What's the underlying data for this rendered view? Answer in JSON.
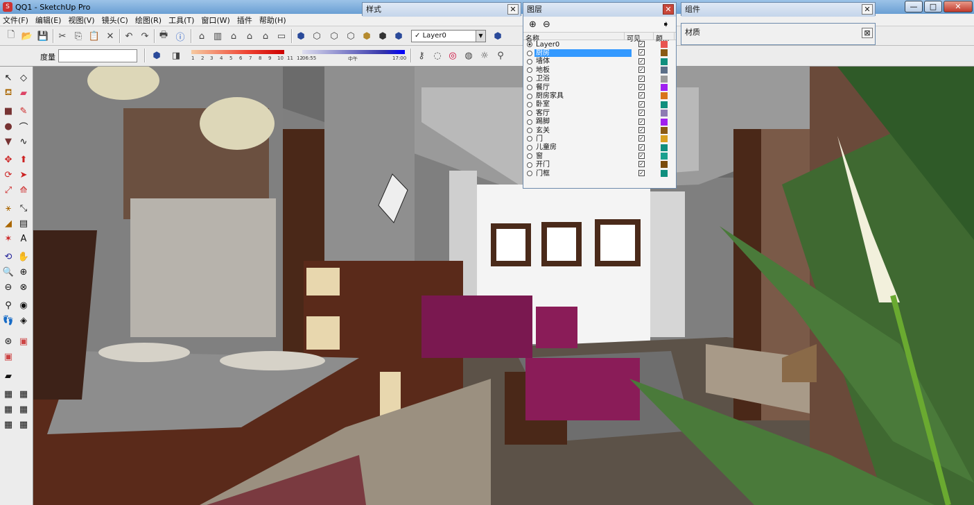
{
  "window": {
    "title": "QQ1 - SketchUp Pro",
    "app_icon": "sketchup-icon"
  },
  "menu": [
    "文件(F)",
    "编辑(E)",
    "视图(V)",
    "镜头(C)",
    "绘图(R)",
    "工具(T)",
    "窗口(W)",
    "插件",
    "帮助(H)"
  ],
  "toolbar": {
    "layer_selected": "Layer0",
    "measure_label": "度量",
    "measure_value": ""
  },
  "shadow": {
    "month_ticks": [
      "1",
      "2",
      "3",
      "4",
      "5",
      "6",
      "7",
      "8",
      "9",
      "10",
      "11",
      "12"
    ],
    "time_start": "06:55",
    "time_mid": "中午",
    "time_end": "17:00"
  },
  "panels": {
    "style_title": "样式",
    "components_title": "组件",
    "materials_title": "材质",
    "layers_title": "图层"
  },
  "layers": {
    "header_name": "名称",
    "header_visible": "可见",
    "header_color": "颜...",
    "rows": [
      {
        "name": "Layer0",
        "visible": true,
        "color": "#e8544f",
        "current": true,
        "selected": false
      },
      {
        "name": "厨房",
        "visible": true,
        "color": "#8a5a14",
        "current": false,
        "selected": true
      },
      {
        "name": "墙体",
        "visible": true,
        "color": "#0f8f7e",
        "current": false,
        "selected": false
      },
      {
        "name": "地板",
        "visible": true,
        "color": "#5b6f88",
        "current": false,
        "selected": false
      },
      {
        "name": "卫浴",
        "visible": true,
        "color": "#9b9b9b",
        "current": false,
        "selected": false
      },
      {
        "name": "餐厅",
        "visible": true,
        "color": "#a020f0",
        "current": false,
        "selected": false
      },
      {
        "name": "厨房家具",
        "visible": true,
        "color": "#d8751a",
        "current": false,
        "selected": false
      },
      {
        "name": "卧室",
        "visible": true,
        "color": "#0f8f7e",
        "current": false,
        "selected": false
      },
      {
        "name": "客厅",
        "visible": true,
        "color": "#8d7bb3",
        "current": false,
        "selected": false
      },
      {
        "name": "踢脚",
        "visible": true,
        "color": "#a020f0",
        "current": false,
        "selected": false
      },
      {
        "name": "玄关",
        "visible": true,
        "color": "#8a5a14",
        "current": false,
        "selected": false
      },
      {
        "name": "门",
        "visible": true,
        "color": "#d8a020",
        "current": false,
        "selected": false
      },
      {
        "name": "儿童房",
        "visible": true,
        "color": "#0f8f7e",
        "current": false,
        "selected": false
      },
      {
        "name": "窗",
        "visible": true,
        "color": "#1aa08f",
        "current": false,
        "selected": false
      },
      {
        "name": "开门",
        "visible": true,
        "color": "#7a4b0c",
        "current": false,
        "selected": false
      },
      {
        "name": "门框",
        "visible": true,
        "color": "#0f8f7e",
        "current": false,
        "selected": false
      }
    ]
  },
  "colors": {
    "selection": "#3399ff",
    "titlebar": "#6a9fd4"
  }
}
